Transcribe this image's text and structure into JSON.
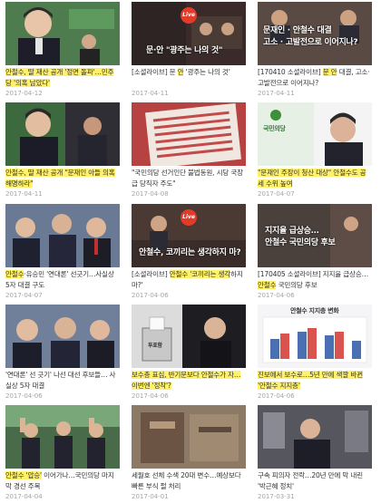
{
  "videos": [
    {
      "title": "안철수, 딸 재산 공개 '정면 돌파'…민주당 '의혹 남았다'",
      "hl": "안철수, 딸 재산 공개 '정면 돌파'…민주당 '의혹 남았다'",
      "date": "2017-04-12",
      "overlay": ""
    },
    {
      "title": "[소셜라이브] 문 안 '광주는 나의 것'",
      "hl": "안",
      "date": "2017-04-11",
      "overlay": "문·안 \"광주는 나의 것\"",
      "badge": "Live"
    },
    {
      "title": "[170410 소셜라이브] 문 안 대결, 고소·고발전으로 이어지나?",
      "hl": "문 안",
      "date": "2017-04-11",
      "overlay": "문재인 · 안철수 대결\n고소 · 고발전으로 이어지나?"
    },
    {
      "title": "안철수, 딸 재산 공개 \"문재인 아들 의혹 해명하라\"",
      "hl": "안철수, 딸 재산 공개 \"문재인 아들 의혹 해명하라\"",
      "date": "2017-04-11",
      "overlay": ""
    },
    {
      "title": "\"국민의당 선거인단 불법동원, 시당 국장급 당직자 주도\"",
      "hl": "",
      "date": "2017-04-08",
      "overlay": ""
    },
    {
      "title": "\"문재인 주장이 청산 대상\" 안철수도 공세 수위 높여",
      "hl": "\"문재인 주장이 청산 대상\" 안철수도 공세 수위 높여",
      "date": "2017-04-07",
      "overlay": "국민의당"
    },
    {
      "title": "안철수·유승민 '연대론' 선긋기…사실상 5자 대결 구도",
      "hl": "안철수",
      "date": "2017-04-07",
      "overlay": ""
    },
    {
      "title": "[소셜라이브] 안철수 '코끼리는 생각하지 마?'",
      "hl": "안철수 '코끼리는 생각",
      "date": "2017-04-06",
      "overlay": "안철수, 코끼리는 생각하지 마?",
      "badge": "Live"
    },
    {
      "title": "[170405 소셜라이브] 지지율 급상승…안철수 국민의당 후보",
      "hl": "안철수",
      "date": "2017-04-06",
      "overlay": "지지율 급상승…\n안철수 국민의당 후보"
    },
    {
      "title": "'연대론' 선 긋기' 나선 대선 후보들… 사실상 5자 대결",
      "hl": "",
      "date": "2017-04-06",
      "overlay": ""
    },
    {
      "title": "보수층 표심, 반기문보다 안철수가 자…이번엔 '정착'?",
      "hl": "보수층 표심, 반기문보다 안철수가 자…이번엔 '정착'?",
      "date": "2017-04-06",
      "overlay": "투표함"
    },
    {
      "title": "진보에서 보수로…5년 만에 색깔 바뀐 '안철수 지지층'",
      "hl": "진보에서 보수로…5년 만에 색깔 바뀐 '안철수 지지층'",
      "date": "2017-04-06",
      "overlay": "안철수 지지층 변화"
    },
    {
      "title": "안철수 '압승' 이어가나…국민의당 마지막 경선 주목",
      "hl": "안철수 '압승'",
      "date": "2017-04-04",
      "overlay": ""
    },
    {
      "title": "세월호 선체 수색 20대 변수…예상보다 빠른 부식 펄 처리",
      "hl": "",
      "date": "2017-04-01",
      "overlay": ""
    },
    {
      "title": "구속 피의자 전락…20년 만에 막 내린 '박근혜 정치'",
      "hl": "",
      "date": "2017-03-31",
      "overlay": ""
    }
  ],
  "colors": {
    "highlight": "#fff16a",
    "date": "#a5a5a5",
    "title": "#333333"
  }
}
